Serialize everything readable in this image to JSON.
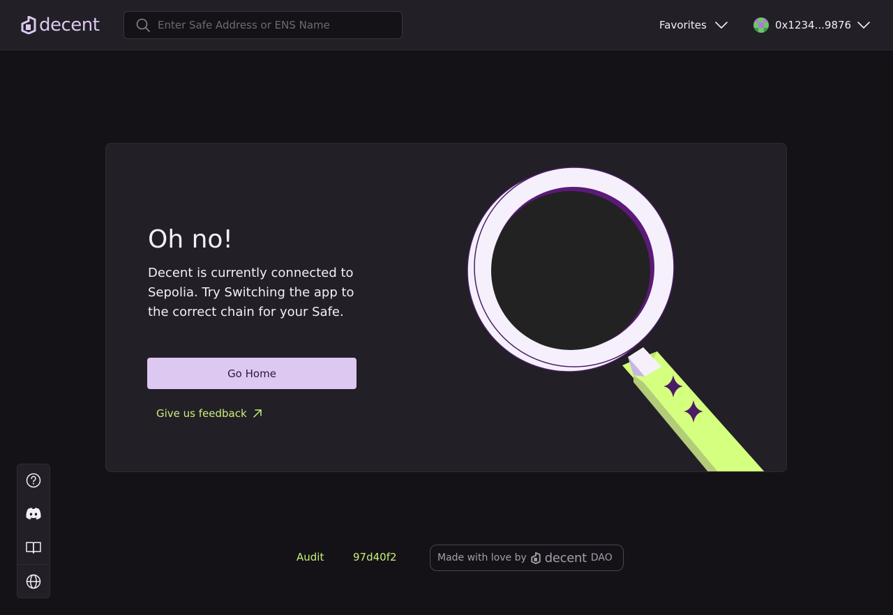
{
  "header": {
    "logo_text": "decent",
    "search_placeholder": "Enter Safe Address or ENS Name",
    "favorites_label": "Favorites",
    "account_label": "0x1234...9876"
  },
  "card": {
    "title": "Oh no!",
    "description": "Decent is currently connected to Sepolia. Try Switching the app to the correct chain for your Safe.",
    "go_home_label": "Go Home",
    "feedback_label": "Give us feedback"
  },
  "sidebar": {
    "items": [
      {
        "icon": "help-icon"
      },
      {
        "icon": "discord-icon"
      },
      {
        "icon": "docs-book-icon"
      },
      {
        "icon": "globe-icon"
      }
    ]
  },
  "footer": {
    "audit_label": "Audit",
    "commit_hash": "97d40f2",
    "made_with_prefix": "Made with love by",
    "made_with_logo": "decent",
    "made_with_suffix": "DAO"
  },
  "colors": {
    "background": "#141217",
    "surface": "#221f26",
    "primary_button": "#dcc8f0",
    "accent_link": "#c8f07a",
    "lens_ring": "#f5f0fb",
    "lens_glass": "#222222",
    "lens_edge": "#5b1a78",
    "handle": "#d4ff7f"
  }
}
